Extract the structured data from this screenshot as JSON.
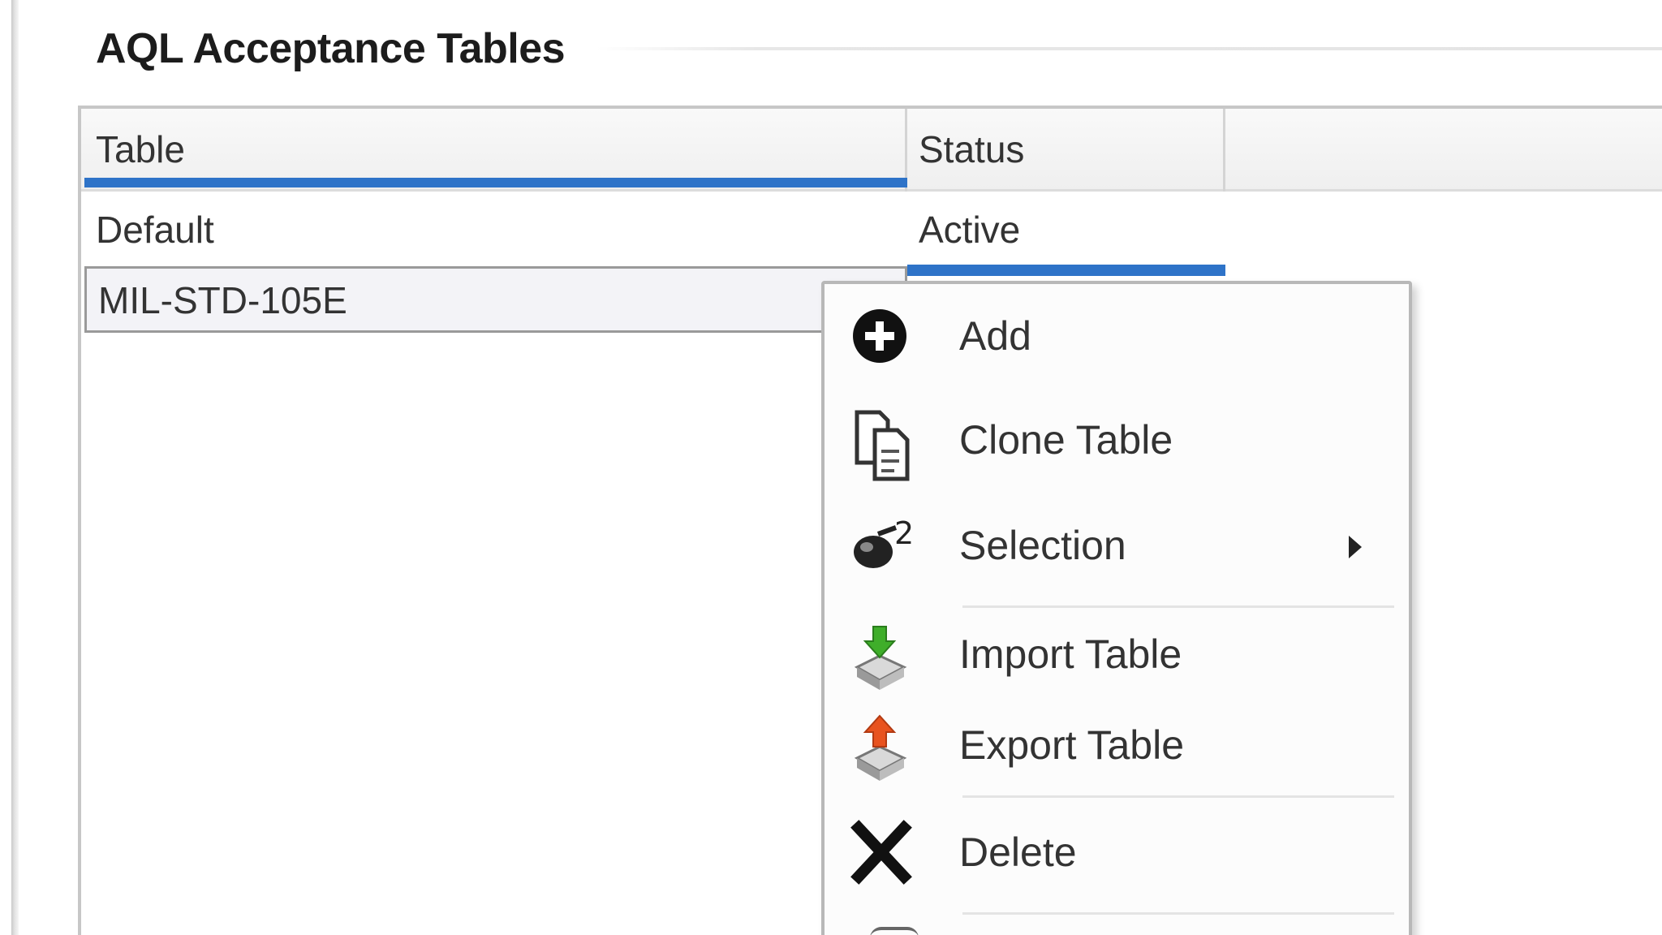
{
  "group": {
    "title": "AQL Acceptance Tables"
  },
  "grid": {
    "columns": [
      "Table",
      "Status"
    ],
    "rows": [
      {
        "table": "Default",
        "status": "Active"
      },
      {
        "table": "MIL-STD-105E",
        "status": ""
      }
    ]
  },
  "context_menu": {
    "items": [
      {
        "label": "Add",
        "icon": "add-circle-icon"
      },
      {
        "label": "Clone Table",
        "icon": "clone-icon"
      },
      {
        "label": "Selection",
        "icon": "selection-icon",
        "has_submenu": true
      },
      {
        "label": "Import Table",
        "icon": "import-icon"
      },
      {
        "label": "Export Table",
        "icon": "export-icon"
      },
      {
        "label": "Delete",
        "icon": "delete-x-icon"
      }
    ]
  },
  "colors": {
    "selection_blue": "#2e73c8",
    "import_green": "#3fae2a",
    "export_orange": "#e8531f"
  }
}
